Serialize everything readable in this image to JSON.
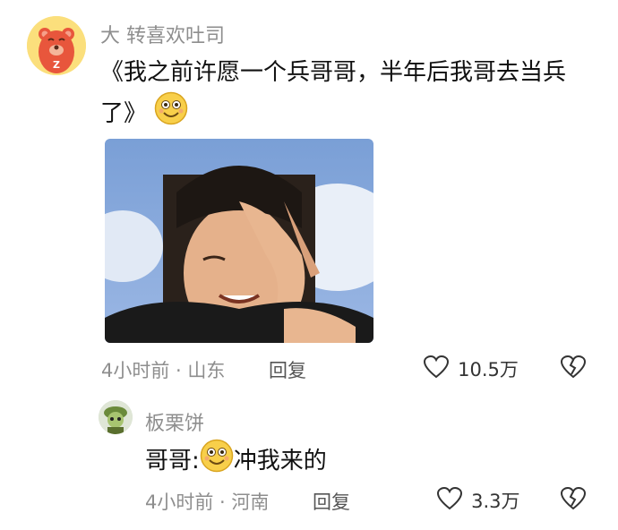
{
  "comment": {
    "username": "大 转喜欢吐司",
    "text_line1": "《我之前许愿一个兵哥哥，半年后我哥去当兵",
    "text_line2": "了》",
    "emoji": "smile-emoji",
    "time_location": "4小时前 · 山东",
    "reply_label": "回复",
    "likes": "10.5万"
  },
  "reply": {
    "username": "板栗饼",
    "text_prefix": "哥哥:",
    "text_suffix": "冲我来的",
    "emoji": "smile-emoji",
    "time_location": "4小时前 · 河南",
    "reply_label": "回复",
    "likes": "3.3万"
  },
  "colors": {
    "meta_gray": "#8e8e8e",
    "text": "#111111",
    "avatar_bg": "#fbdf7c",
    "avatar_bear": "#e8563c",
    "emoji_yellow": "#f8cf4a"
  },
  "icons": [
    "heart-icon",
    "dislike-heart-icon"
  ]
}
